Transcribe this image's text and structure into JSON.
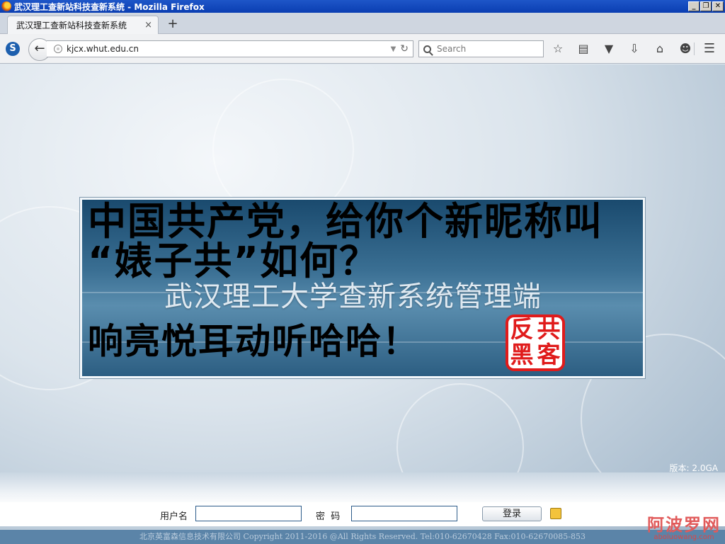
{
  "window": {
    "title": "武汉理工查新站科技查新系统 - Mozilla Firefox",
    "controls": {
      "minimize": "_",
      "restore": "❐",
      "close": "✕"
    }
  },
  "tabs": [
    {
      "label": "武汉理工查新站科技查新系统",
      "close": "×"
    }
  ],
  "new_tab": "+",
  "navbar": {
    "url": "kjcx.whut.edu.cn",
    "search_placeholder": "Search"
  },
  "page": {
    "defaced_line1": "中国共产党，给你个新昵称叫",
    "defaced_line2": "“婊子共”如何？",
    "system_title": "武汉理工大学查新系统管理端",
    "defaced_line3": "响亮悦耳动听哈哈！",
    "seal": [
      "反",
      "共",
      "黑",
      "客"
    ],
    "version": "版本: 2.0GA",
    "login": {
      "username_label": "用户名",
      "password_label": "密  码",
      "submit_label": "登录"
    },
    "copyright": "北京英富森信息技术有限公司 Copyright 2011-2016 @All Rights Reserved. Tel:010-62670428 Fax:010-62670085-853"
  },
  "watermark": {
    "text": "阿波罗网",
    "url": "aboluowang.com"
  },
  "colors": {
    "seal": "#e01b1b",
    "titlebar": "#0a3eb2",
    "footer": "#5b84a8"
  }
}
